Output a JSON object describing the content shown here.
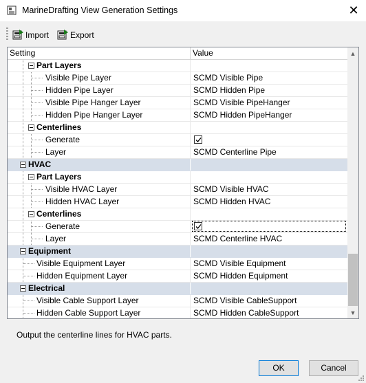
{
  "window": {
    "title": "MarineDrafting View Generation Settings",
    "close_icon": "close-icon"
  },
  "toolbar": {
    "import_label": "Import",
    "export_label": "Export"
  },
  "grid": {
    "header_setting": "Setting",
    "header_value": "Value",
    "rows": [
      {
        "label": "Part Layers",
        "value": "",
        "kind": "subgroup"
      },
      {
        "label": "Visible Pipe Layer",
        "value": "SCMD Visible Pipe",
        "kind": "item"
      },
      {
        "label": "Hidden Pipe Layer",
        "value": "SCMD Hidden Pipe",
        "kind": "item"
      },
      {
        "label": "Visible Pipe Hanger Layer",
        "value": "SCMD Visible PipeHanger",
        "kind": "item"
      },
      {
        "label": "Hidden Pipe Hanger Layer",
        "value": "SCMD Hidden PipeHanger",
        "kind": "item"
      },
      {
        "label": "Centerlines",
        "value": "",
        "kind": "subgroup"
      },
      {
        "label": "Generate",
        "value": "",
        "kind": "checkbox",
        "checked": true
      },
      {
        "label": "Layer",
        "value": "SCMD Centerline Pipe",
        "kind": "item"
      },
      {
        "label": "HVAC",
        "value": "",
        "kind": "group"
      },
      {
        "label": "Part Layers",
        "value": "",
        "kind": "subgroup"
      },
      {
        "label": "Visible HVAC Layer",
        "value": "SCMD Visible HVAC",
        "kind": "item"
      },
      {
        "label": "Hidden HVAC Layer",
        "value": "SCMD Hidden HVAC",
        "kind": "item"
      },
      {
        "label": "Centerlines",
        "value": "",
        "kind": "subgroup"
      },
      {
        "label": "Generate",
        "value": "",
        "kind": "checkbox",
        "checked": true,
        "focused": true
      },
      {
        "label": "Layer",
        "value": "SCMD Centerline HVAC",
        "kind": "item"
      },
      {
        "label": "Equipment",
        "value": "",
        "kind": "group"
      },
      {
        "label": "Visible Equipment Layer",
        "value": "SCMD Visible Equipment",
        "kind": "item2"
      },
      {
        "label": "Hidden Equipment Layer",
        "value": "SCMD Hidden Equipment",
        "kind": "item2"
      },
      {
        "label": "Electrical",
        "value": "",
        "kind": "group"
      },
      {
        "label": "Visible Cable Support Layer",
        "value": "SCMD Visible CableSupport",
        "kind": "item2"
      },
      {
        "label": "Hidden Cable Support Layer",
        "value": "SCMD Hidden CableSupport",
        "kind": "item2"
      }
    ]
  },
  "description": "Output the centerline lines for HVAC parts.",
  "buttons": {
    "ok_label": "OK",
    "cancel_label": "Cancel"
  },
  "colors": {
    "group_row": "#d6dee9",
    "ok_border": "#0078d7"
  }
}
